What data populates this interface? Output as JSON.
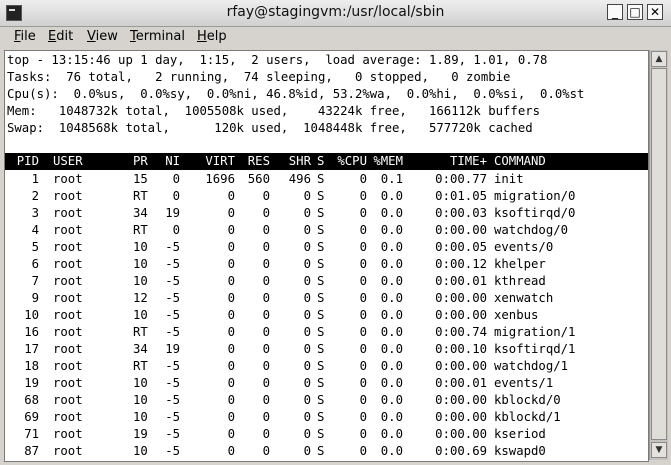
{
  "window": {
    "title": "rfay@stagingvm:/usr/local/sbin",
    "min": "_",
    "max": "□",
    "close": "✕"
  },
  "menu": [
    {
      "key": "F",
      "rest": "ile"
    },
    {
      "key": "E",
      "rest": "dit"
    },
    {
      "key": "V",
      "rest": "iew"
    },
    {
      "key": "T",
      "rest": "erminal"
    },
    {
      "key": "H",
      "rest": "elp"
    }
  ],
  "summary": [
    "top - 13:15:46 up 1 day,  1:15,  2 users,  load average: 1.89, 1.01, 0.78",
    "Tasks:  76 total,   2 running,  74 sleeping,   0 stopped,   0 zombie",
    "Cpu(s):  0.0%us,  0.0%sy,  0.0%ni, 46.8%id, 53.2%wa,  0.0%hi,  0.0%si,  0.0%st",
    "Mem:   1048732k total,  1005508k used,    43224k free,   166112k buffers",
    "Swap:  1048568k total,      120k used,  1048448k free,   577720k cached"
  ],
  "columns": [
    "PID",
    "USER",
    "PR",
    "NI",
    "VIRT",
    "RES",
    "SHR",
    "S",
    "%CPU",
    "%MEM",
    "TIME+",
    "COMMAND"
  ],
  "processes": [
    [
      "1",
      "root",
      "15",
      "0",
      "1696",
      "560",
      "496",
      "S",
      "0",
      "0.1",
      "0:00.77",
      "init"
    ],
    [
      "2",
      "root",
      "RT",
      "0",
      "0",
      "0",
      "0",
      "S",
      "0",
      "0.0",
      "0:01.05",
      "migration/0"
    ],
    [
      "3",
      "root",
      "34",
      "19",
      "0",
      "0",
      "0",
      "S",
      "0",
      "0.0",
      "0:00.03",
      "ksoftirqd/0"
    ],
    [
      "4",
      "root",
      "RT",
      "0",
      "0",
      "0",
      "0",
      "S",
      "0",
      "0.0",
      "0:00.00",
      "watchdog/0"
    ],
    [
      "5",
      "root",
      "10",
      "-5",
      "0",
      "0",
      "0",
      "S",
      "0",
      "0.0",
      "0:00.05",
      "events/0"
    ],
    [
      "6",
      "root",
      "10",
      "-5",
      "0",
      "0",
      "0",
      "S",
      "0",
      "0.0",
      "0:00.12",
      "khelper"
    ],
    [
      "7",
      "root",
      "10",
      "-5",
      "0",
      "0",
      "0",
      "S",
      "0",
      "0.0",
      "0:00.01",
      "kthread"
    ],
    [
      "9",
      "root",
      "12",
      "-5",
      "0",
      "0",
      "0",
      "S",
      "0",
      "0.0",
      "0:00.00",
      "xenwatch"
    ],
    [
      "10",
      "root",
      "10",
      "-5",
      "0",
      "0",
      "0",
      "S",
      "0",
      "0.0",
      "0:00.00",
      "xenbus"
    ],
    [
      "16",
      "root",
      "RT",
      "-5",
      "0",
      "0",
      "0",
      "S",
      "0",
      "0.0",
      "0:00.74",
      "migration/1"
    ],
    [
      "17",
      "root",
      "34",
      "19",
      "0",
      "0",
      "0",
      "S",
      "0",
      "0.0",
      "0:00.10",
      "ksoftirqd/1"
    ],
    [
      "18",
      "root",
      "RT",
      "-5",
      "0",
      "0",
      "0",
      "S",
      "0",
      "0.0",
      "0:00.00",
      "watchdog/1"
    ],
    [
      "19",
      "root",
      "10",
      "-5",
      "0",
      "0",
      "0",
      "S",
      "0",
      "0.0",
      "0:00.01",
      "events/1"
    ],
    [
      "68",
      "root",
      "10",
      "-5",
      "0",
      "0",
      "0",
      "S",
      "0",
      "0.0",
      "0:00.00",
      "kblockd/0"
    ],
    [
      "69",
      "root",
      "10",
      "-5",
      "0",
      "0",
      "0",
      "S",
      "0",
      "0.0",
      "0:00.00",
      "kblockd/1"
    ],
    [
      "71",
      "root",
      "19",
      "-5",
      "0",
      "0",
      "0",
      "S",
      "0",
      "0.0",
      "0:00.00",
      "kseriod"
    ],
    [
      "87",
      "root",
      "10",
      "-5",
      "0",
      "0",
      "0",
      "S",
      "0",
      "0.0",
      "0:00.69",
      "kswapd0"
    ]
  ],
  "colors": {
    "header_bg": "#000000",
    "header_fg": "#ffffff",
    "terminal_bg": "#ffffff"
  }
}
